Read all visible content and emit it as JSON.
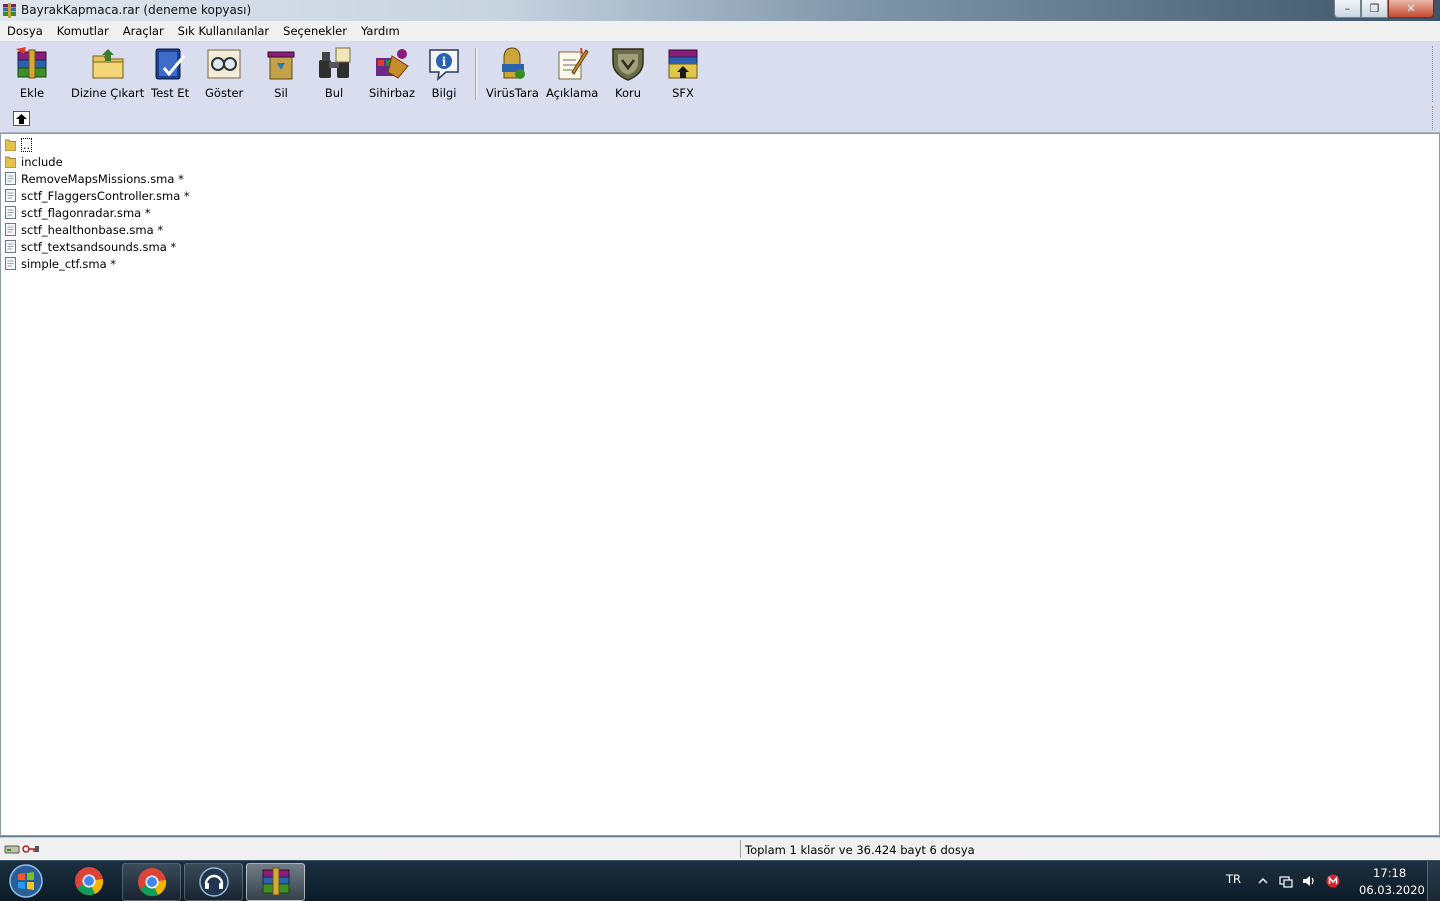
{
  "window": {
    "title": "BayrakKapmaca.rar (deneme kopyası)",
    "minimize_glyph": "–",
    "maximize_glyph": "❐",
    "close_glyph": "✕"
  },
  "menu": [
    "Dosya",
    "Komutlar",
    "Araçlar",
    "Sık Kullanılanlar",
    "Seçenekler",
    "Yardım"
  ],
  "toolbar": {
    "buttons": [
      {
        "label": "Ekle",
        "icon": "add-archive-icon"
      },
      {
        "label": "Dizine Çıkart",
        "icon": "extract-to-folder-icon"
      },
      {
        "label": "Test Et",
        "icon": "test-archive-icon"
      },
      {
        "label": "Göster",
        "icon": "view-glasses-icon"
      },
      {
        "label": "Sil",
        "icon": "delete-bin-icon"
      },
      {
        "label": "Bul",
        "icon": "find-binoculars-icon"
      },
      {
        "label": "Sihirbaz",
        "icon": "wizard-icon"
      },
      {
        "label": "Bilgi",
        "icon": "info-icon"
      },
      {
        "label": "VirüsTara",
        "icon": "virus-scan-icon"
      },
      {
        "label": "Açıklama",
        "icon": "comment-icon"
      },
      {
        "label": "Koru",
        "icon": "protect-shield-icon"
      },
      {
        "label": "SFX",
        "icon": "sfx-archive-icon"
      }
    ]
  },
  "address": {
    "up_icon": "up-folder-icon"
  },
  "files": [
    {
      "name": "..",
      "type": "updir"
    },
    {
      "name": "include",
      "type": "folder"
    },
    {
      "name": "RemoveMapsMissions.sma *",
      "type": "file"
    },
    {
      "name": "sctf_FlaggersController.sma *",
      "type": "file"
    },
    {
      "name": "sctf_flagonradar.sma *",
      "type": "file"
    },
    {
      "name": "sctf_healthonbase.sma *",
      "type": "file"
    },
    {
      "name": "sctf_textsandsounds.sma *",
      "type": "file"
    },
    {
      "name": "simple_ctf.sma *",
      "type": "file"
    }
  ],
  "status": {
    "text": "Toplam 1 klasör ve 36.424 bayt 6 dosya",
    "icons": [
      "drive-icon",
      "key-lock-icon"
    ]
  },
  "taskbar": {
    "language": "TR",
    "time": "17:18",
    "date": "06.03.2020",
    "items": [
      "chrome-icon",
      "chrome-icon",
      "teamspeak-icon",
      "winrar-icon"
    ]
  }
}
